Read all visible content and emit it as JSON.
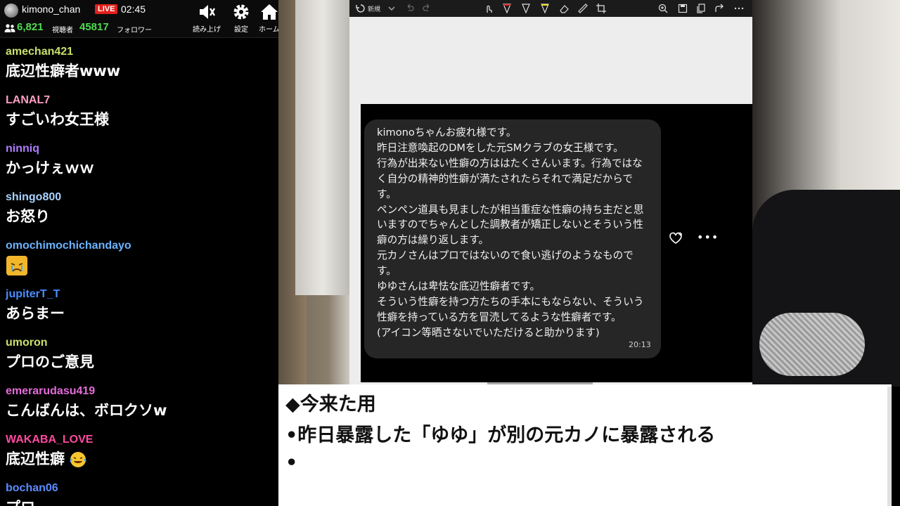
{
  "header": {
    "username": "kimono_chan",
    "live_badge": "LIVE",
    "time": "02:45",
    "viewers_count": "6,821",
    "viewers_label": "視聴者",
    "followers_count": "45817",
    "followers_label": "フォロワー",
    "buttons": [
      {
        "label": "読み上げ",
        "icon": "speaker-icon"
      },
      {
        "label": "設定",
        "icon": "gear-icon"
      },
      {
        "label": "ホーム",
        "icon": "home-icon"
      }
    ]
  },
  "chat": [
    {
      "user": "amechan421",
      "color": "#c9e06a",
      "text": "底辺性癖者www"
    },
    {
      "user": "LANAL7",
      "color": "#ff9ec4",
      "text": "すごいわ女王様"
    },
    {
      "user": "ninniq",
      "color": "#b07cff",
      "text": "かっけぇｗｗ"
    },
    {
      "user": "shingo800",
      "color": "#a8d4ff",
      "text": "お怒り"
    },
    {
      "user": "omochimochichandayo",
      "color": "#6ab4ff",
      "text": "",
      "emoji": "crying-face-emoji"
    },
    {
      "user": "jupiterT_T",
      "color": "#4a8cff",
      "text": "あらまー"
    },
    {
      "user": "umoron",
      "color": "#c9e06a",
      "text": "プロのご意見"
    },
    {
      "user": "emerarudasu419",
      "color": "#e46bd9",
      "text": "こんばんは、ボロクソw"
    },
    {
      "user": "WAKABA_LOVE",
      "color": "#ff4aa0",
      "text": "底辺性癖",
      "emoji": "laughing-emoji"
    },
    {
      "user": "bochan06",
      "color": "#5b8cff",
      "text": "プロ"
    }
  ],
  "viewer": {
    "new_label": "新規",
    "dm_text": "kimonoちゃんお疲れ様です。\n昨日注意喚起のDMをした元SMクラブの女王様です。\n行為が出来ない性癖の方ははたくさんいます。行為ではなく自分の精神的性癖が満たされたらそれで満足だからです。\nペンペン道具も見ましたが相当重症な性癖の持ち主だと思いますのでちゃんとした調教者が矯正しないとそういう性癖の方は繰り返します。\n元カノさんはプロではないので食い逃げのようなものです。\nゆゆさんは卑怯な底辺性癖者です。\nそういう性癖を持つ方たちの手本にもならない、そういう性癖を持っている方を冒涜してるような性癖者です。\n(アイコン等晒さないでいただけると助かります)",
    "dm_time": "20:13"
  },
  "notes": {
    "lines": [
      "◆今来た用",
      "•昨日暴露した「ゆゆ」が別の元カノに暴露される",
      "•"
    ]
  }
}
